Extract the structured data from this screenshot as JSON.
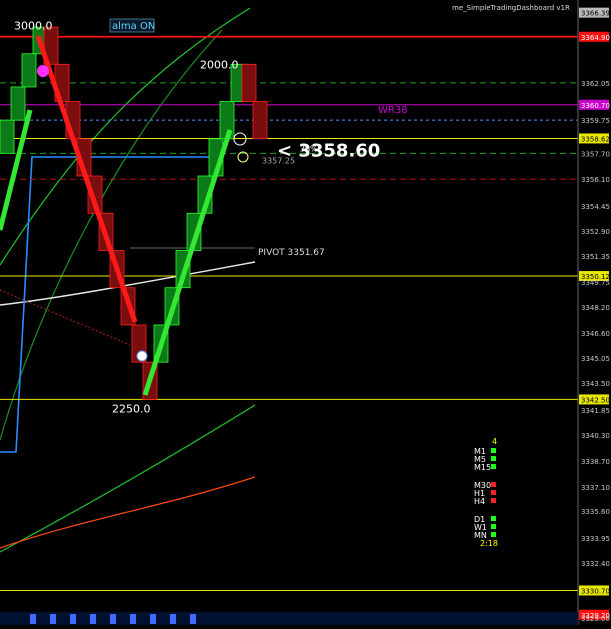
{
  "window": {
    "title": "me_SimpleTradingDashboard v1R"
  },
  "badge": {
    "label": "alma ON"
  },
  "colors": {
    "background": "#000000",
    "bull_body": "#0d7a1a",
    "bull_edge": "#2cff2c",
    "bear_body": "#7a0d0d",
    "bear_edge": "#ff2020",
    "red_level": "#ff1010",
    "yellow_level": "#e8e800",
    "magenta_level": "#cc00cc",
    "green_dash": "#1ea11e",
    "blue_line": "#2a8cff",
    "white_ma": "#e8e8e8",
    "orange_band": "#ff4a12",
    "green_band": "#22c22e",
    "grid_text": "#c8c8c8"
  },
  "chart_data": {
    "type": "renko",
    "y_axis": {
      "range": [
        3329,
        3366.8
      ],
      "tick_labels": [
        "3366.39",
        "3364.90",
        "3362.05",
        "3360.70",
        "3359.75",
        "3358.62",
        "3357.70",
        "3356.10",
        "3354.45",
        "3352.90",
        "3351.35",
        "3350.12",
        "3349.75",
        "3348.20",
        "3346.60",
        "3345.05",
        "3343.50",
        "3342.50",
        "3341.85",
        "3340.30",
        "3338.70",
        "3337.10",
        "3335.60",
        "3333.95",
        "3332.40",
        "3330.70",
        "3329.20",
        "3329.00"
      ]
    },
    "bricks": [
      {
        "o": 3357.7,
        "c": 3359.75
      },
      {
        "o": 3359.75,
        "c": 3361.8
      },
      {
        "o": 3361.8,
        "c": 3363.85
      },
      {
        "o": 3363.85,
        "c": 3365.5
      },
      {
        "o": 3365.5,
        "c": 3363.2
      },
      {
        "o": 3363.2,
        "c": 3360.9
      },
      {
        "o": 3360.9,
        "c": 3358.6
      },
      {
        "o": 3358.6,
        "c": 3356.3
      },
      {
        "o": 3356.3,
        "c": 3354.0
      },
      {
        "o": 3354.0,
        "c": 3351.7
      },
      {
        "o": 3351.7,
        "c": 3349.4
      },
      {
        "o": 3349.4,
        "c": 3347.1
      },
      {
        "o": 3347.1,
        "c": 3344.8
      },
      {
        "o": 3344.8,
        "c": 3342.5
      },
      {
        "o": 3344.8,
        "c": 3347.1
      },
      {
        "o": 3347.1,
        "c": 3349.4
      },
      {
        "o": 3349.4,
        "c": 3351.7
      },
      {
        "o": 3351.7,
        "c": 3354.0
      },
      {
        "o": 3354.0,
        "c": 3356.3
      },
      {
        "o": 3356.3,
        "c": 3358.6
      },
      {
        "o": 3358.6,
        "c": 3360.9
      },
      {
        "o": 3360.9,
        "c": 3363.2
      },
      {
        "o": 3363.2,
        "c": 3360.9
      },
      {
        "o": 3360.9,
        "c": 3358.6
      }
    ],
    "levels": [
      {
        "price": 3364.9,
        "kind": "red"
      },
      {
        "price": 3362.05,
        "kind": "green-dash"
      },
      {
        "price": 3360.7,
        "kind": "magenta",
        "label": "WR38"
      },
      {
        "price": 3359.75,
        "kind": "blue-dash"
      },
      {
        "price": 3358.62,
        "kind": "yellow"
      },
      {
        "price": 3357.7,
        "kind": "green-dash"
      },
      {
        "price": 3356.1,
        "kind": "red-dash"
      },
      {
        "price": 3350.12,
        "kind": "yellow"
      },
      {
        "price": 3342.5,
        "kind": "yellow"
      },
      {
        "price": 3330.7,
        "kind": "yellow"
      },
      {
        "price": 3329.2,
        "kind": "red"
      }
    ],
    "pivot": {
      "label": "PIVOT 3351.67",
      "price": 3351.67
    },
    "annotations": [
      {
        "text": "3000.0",
        "price": 3365.6
      },
      {
        "text": "2000.0",
        "price": 3363.2
      },
      {
        "text": "2250.0",
        "price": 3342.2
      }
    ],
    "last_price_text": "<  3358.60",
    "sub_price_text": "3357.25",
    "small_label": "38%"
  },
  "dashboard": {
    "top_count": "4",
    "groups": [
      [
        {
          "label": "M1",
          "status": "green"
        },
        {
          "label": "M5",
          "status": "green"
        },
        {
          "label": "M15",
          "status": "green"
        }
      ],
      [
        {
          "label": "M30",
          "status": "red"
        },
        {
          "label": "H1",
          "status": "red"
        },
        {
          "label": "H4",
          "status": "red"
        }
      ],
      [
        {
          "label": "D1",
          "status": "green"
        },
        {
          "label": "W1",
          "status": "green"
        },
        {
          "label": "MN",
          "status": "green"
        }
      ]
    ],
    "timer": "2:18"
  }
}
